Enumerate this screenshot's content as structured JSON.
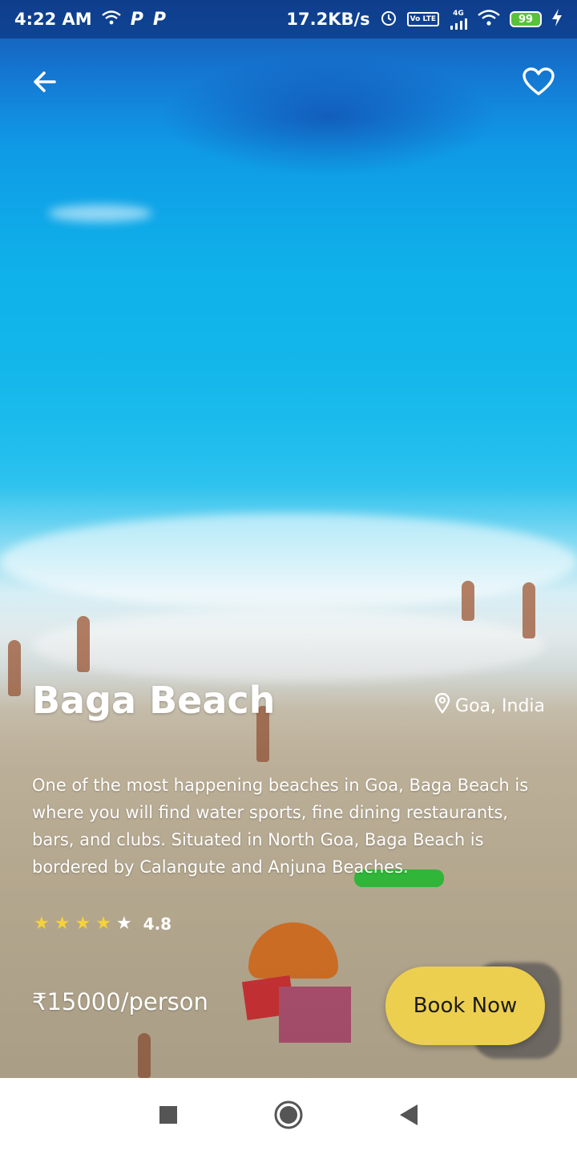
{
  "status_bar": {
    "time": "4:22 AM",
    "left_icons": [
      "wifi-icon",
      "p-icon",
      "p-icon"
    ],
    "p_letter": "P",
    "network_speed": "17.2KB/s",
    "network_type": "4G",
    "volte": "Vo LTE",
    "battery": "99"
  },
  "header": {
    "back_icon": "arrow-left-icon",
    "favorite_icon": "heart-outline-icon"
  },
  "destination": {
    "title": "Baga Beach",
    "location": "Goa, India",
    "description": "One of the most happening beaches in Goa, Baga Beach is where you will find water sports, fine dining restaurants, bars, and clubs. Situated in North Goa, Baga Beach is bordered by Calangute and Anjuna Beaches.",
    "rating": {
      "stars_filled": 4,
      "stars_total": 5,
      "value": "4.8"
    },
    "price": "₹15000/person",
    "book_button_label": "Book Now"
  },
  "colors": {
    "accent": "#eccf4e",
    "star": "#f5d23a",
    "text_light": "#ffffff",
    "battery": "#58c23a"
  },
  "nav_bar": {
    "icons": [
      "recent-apps-icon",
      "home-icon",
      "back-icon"
    ]
  }
}
